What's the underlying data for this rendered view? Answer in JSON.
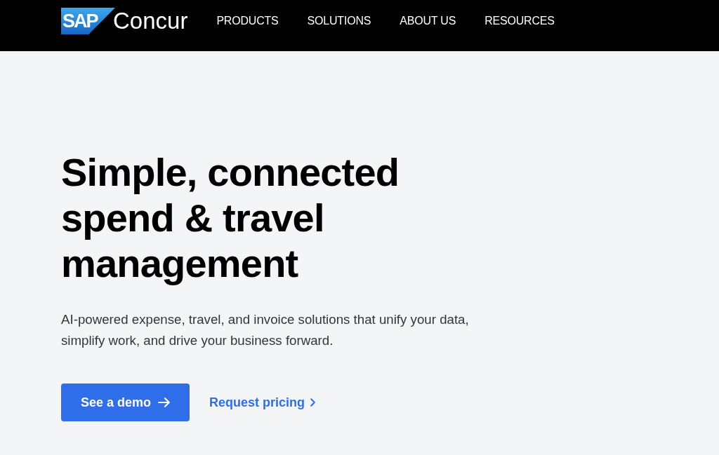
{
  "header": {
    "logo": {
      "badge": "SAP",
      "wordmark": "Concur"
    },
    "nav": [
      "PRODUCTS",
      "SOLUTIONS",
      "ABOUT US",
      "RESOURCES"
    ]
  },
  "hero": {
    "headline": "Simple, connected spend & travel management",
    "description": "AI-powered expense, travel, and invoice solutions that unify your data, simplify work, and drive your business forward.",
    "actions": [
      {
        "kind": "primary",
        "label": "See a demo"
      },
      {
        "kind": "link",
        "label": "Request pricing"
      }
    ]
  }
}
